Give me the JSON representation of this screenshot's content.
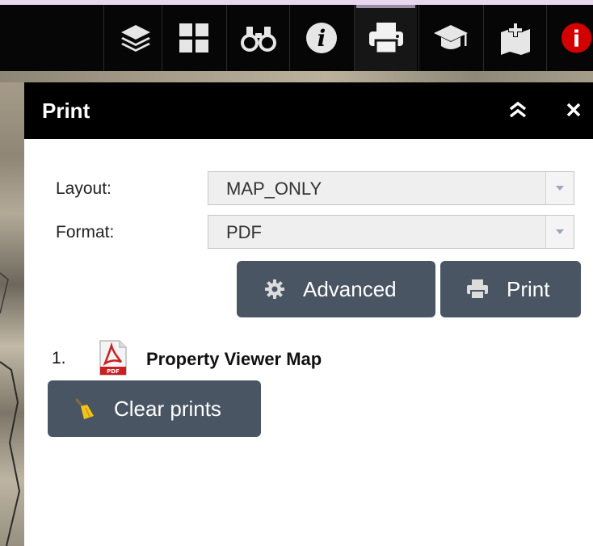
{
  "toolbar": {
    "items": [
      {
        "icon": "layers-icon",
        "active": false
      },
      {
        "icon": "grid-icon",
        "active": false
      },
      {
        "icon": "binoculars-icon",
        "active": false
      },
      {
        "icon": "info-icon",
        "active": false
      },
      {
        "icon": "printer-icon",
        "active": true
      },
      {
        "icon": "graduation-cap-icon",
        "active": false
      },
      {
        "icon": "add-map-icon",
        "active": false
      },
      {
        "icon": "alert-info-icon",
        "active": false
      }
    ]
  },
  "panel": {
    "title": "Print",
    "layout_label": "Layout:",
    "layout_value": "MAP_ONLY",
    "format_label": "Format:",
    "format_value": "PDF",
    "advanced_label": "Advanced",
    "print_label": "Print",
    "prints": [
      {
        "number": "1.",
        "title": "Property Viewer Map",
        "icon": "pdf-icon"
      }
    ],
    "clear_label": "Clear prints"
  },
  "colors": {
    "button_bg": "#4a5564",
    "header_bg": "#000000",
    "alert_red": "#d40000",
    "pdf_red": "#cc1f1f"
  }
}
